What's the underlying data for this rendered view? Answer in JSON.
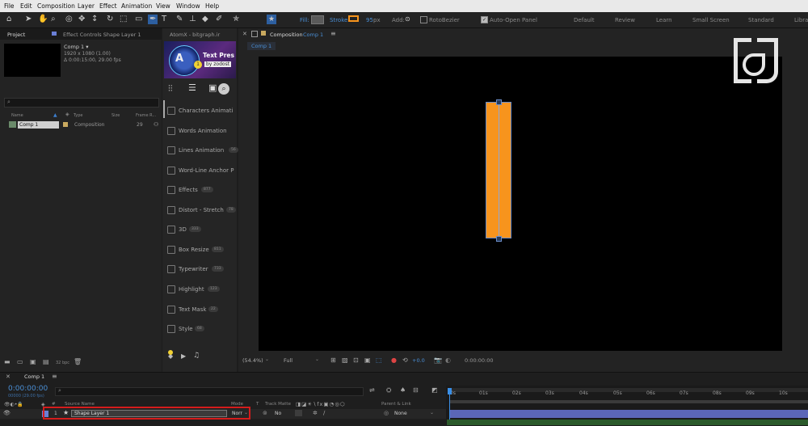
{
  "menu": [
    "File",
    "Edit",
    "Composition",
    "Layer",
    "Effect",
    "Animation",
    "View",
    "Window",
    "Help"
  ],
  "toolbar": {
    "fill_label": "Fill:",
    "stroke_label": "Stroke:",
    "stroke_width": "95",
    "stroke_unit": "px",
    "add_label": "Add:",
    "rotobezier_label": "RotoBezier",
    "autoopen_label": "Auto-Open Panel",
    "workspaces": [
      "Default",
      "Review",
      "Learn",
      "Small Screen",
      "Standard",
      "Librar"
    ]
  },
  "project": {
    "tab_project": "Project",
    "tab_effect_controls": "Effect Controls Shape Layer 1",
    "comp_name": "Comp 1 ▾",
    "comp_size": "1920 x 1080 (1.00)",
    "comp_duration": "Δ 0:00:15:00, 29.00 fps",
    "search_placeholder": "",
    "col_name": "Name",
    "col_type": "Type",
    "col_size": "Size",
    "col_frame": "Frame R...",
    "item_name": "Comp 1",
    "item_type": "Composition",
    "item_frame": "29",
    "bpc": "32 bpc"
  },
  "atomx": {
    "tab": "AtomX - bitgraph.ir",
    "banner_title": "Text Pres",
    "banner_by": "by zodost",
    "items": [
      {
        "label": "Characters Animati",
        "badge": ""
      },
      {
        "label": "Words Animation",
        "badge": ""
      },
      {
        "label": "Lines Animation",
        "badge": "56"
      },
      {
        "label": "Word-Line Anchor P",
        "badge": ""
      },
      {
        "label": "Effects",
        "badge": "877"
      },
      {
        "label": "Distort - Stretch",
        "badge": "78"
      },
      {
        "label": "3D",
        "badge": "333"
      },
      {
        "label": "Box Resize",
        "badge": "811"
      },
      {
        "label": "Typewriter",
        "badge": "733"
      },
      {
        "label": "Highlight",
        "badge": "123"
      },
      {
        "label": "Text Mask",
        "badge": "22"
      },
      {
        "label": "Style",
        "badge": "68"
      }
    ]
  },
  "composition": {
    "tab_prefix": "Composition",
    "tab_name": "Comp 1",
    "sub_tab": "Comp 1",
    "zoom": "(54.4%)",
    "resolution": "Full",
    "exposure": "+0.0",
    "timecode": "0:00:00:00",
    "shape_color": "#f7941d"
  },
  "timeline": {
    "tab": "Comp 1",
    "timecode": "0:00:00:00",
    "timecode_sub": "00000 (29.00 fps)",
    "col_source": "Source Name",
    "col_mode": "Mode",
    "col_t": "T",
    "col_trackmatte": "Track Matte",
    "col_parent": "Parent & Link",
    "layer_number": "1",
    "layer_name": "Shape Layer 1",
    "layer_mode": "Norr",
    "layer_matte": "No",
    "layer_parent": "None",
    "ruler": [
      "0s",
      "01s",
      "02s",
      "03s",
      "04s",
      "05s",
      "06s",
      "07s",
      "08s",
      "09s",
      "10s"
    ]
  }
}
